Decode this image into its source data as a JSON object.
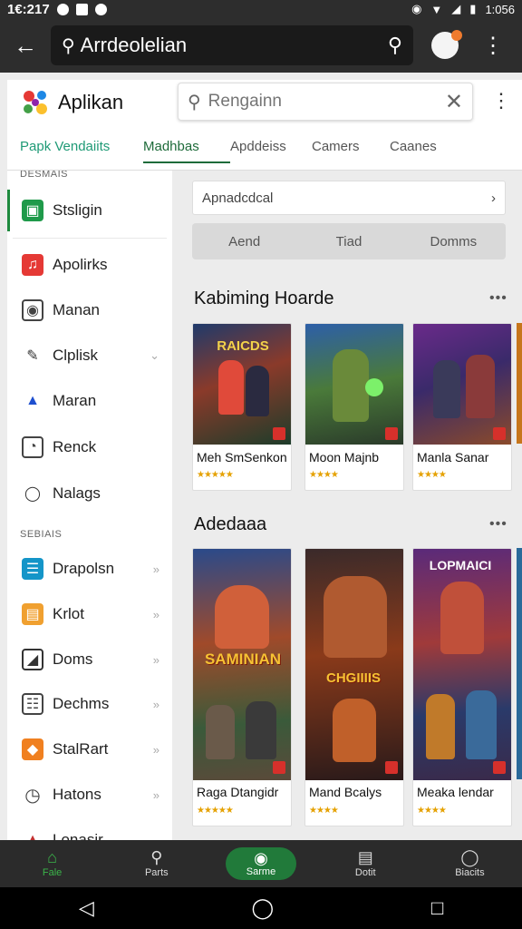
{
  "status_bar": {
    "time": "1€:217",
    "right_time": "1:056"
  },
  "top_bar": {
    "search_value": "Arrdeolelian"
  },
  "app_header": {
    "brand": "Aplikan",
    "search_placeholder": "Rengainn",
    "tabs": [
      "Papk Vendaiits",
      "Madhbas",
      "Apddeiss",
      "Camers",
      "Caanes"
    ]
  },
  "drawer": {
    "section1": "DESMAIS",
    "section2": "SEBIAIS",
    "items": [
      {
        "label": "Stsligin",
        "icon": "lock-icon",
        "color": "#1f9a4a"
      },
      {
        "label": "Apolirks",
        "icon": "music-icon",
        "color": "#e53935"
      },
      {
        "label": "Manan",
        "icon": "monitor-icon",
        "color": "#444444"
      },
      {
        "label": "Clplisk",
        "icon": "pencil-icon",
        "color": "#333333"
      },
      {
        "label": "Maran",
        "icon": "drive-icon",
        "color": "#1e4fcf"
      },
      {
        "label": "Renck",
        "icon": "image-icon",
        "color": "#444444"
      },
      {
        "label": "Nalags",
        "icon": "person-icon",
        "color": "#333333"
      },
      {
        "label": "Drapolsn",
        "icon": "list-icon",
        "color": "#1495c8"
      },
      {
        "label": "Krlot",
        "icon": "folder-icon",
        "color": "#f0a030"
      },
      {
        "label": "Doms",
        "icon": "square-icon",
        "color": "#333333"
      },
      {
        "label": "Dechms",
        "icon": "grid-icon",
        "color": "#444444"
      },
      {
        "label": "StalRart",
        "icon": "box-icon",
        "color": "#f08020"
      },
      {
        "label": "Hatons",
        "icon": "clock-icon",
        "color": "#444444"
      },
      {
        "label": "Lonasir",
        "icon": "chart-icon",
        "color": "#c33030"
      }
    ]
  },
  "main": {
    "dropdown": "Apnadcdcal",
    "segments": [
      "Aend",
      "Tiad",
      "Domms"
    ],
    "section1_title": "Kabiming Hoarde",
    "section2_title": "Adedaaa",
    "row1": [
      {
        "name": "Meh SmSenkon",
        "art_title": "RAICDS"
      },
      {
        "name": "Moon Majnb",
        "art_title": ""
      },
      {
        "name": "Manla Sanar",
        "art_title": ""
      }
    ],
    "row2": [
      {
        "name": "Raga Dtangidr",
        "art_title": "SAMINIAN"
      },
      {
        "name": "Mand Bcalys",
        "art_title": "CHGIIIIS"
      },
      {
        "name": "Meaka lendar",
        "art_title": "LOPMAICI"
      }
    ]
  },
  "bottom_nav": [
    "Fale",
    "Parts",
    "Sarme",
    "Dotit",
    "Biacits"
  ],
  "colors": {
    "accent": "#1e8a3e",
    "topbar": "#2d2d2d",
    "star": "#e5a100"
  }
}
